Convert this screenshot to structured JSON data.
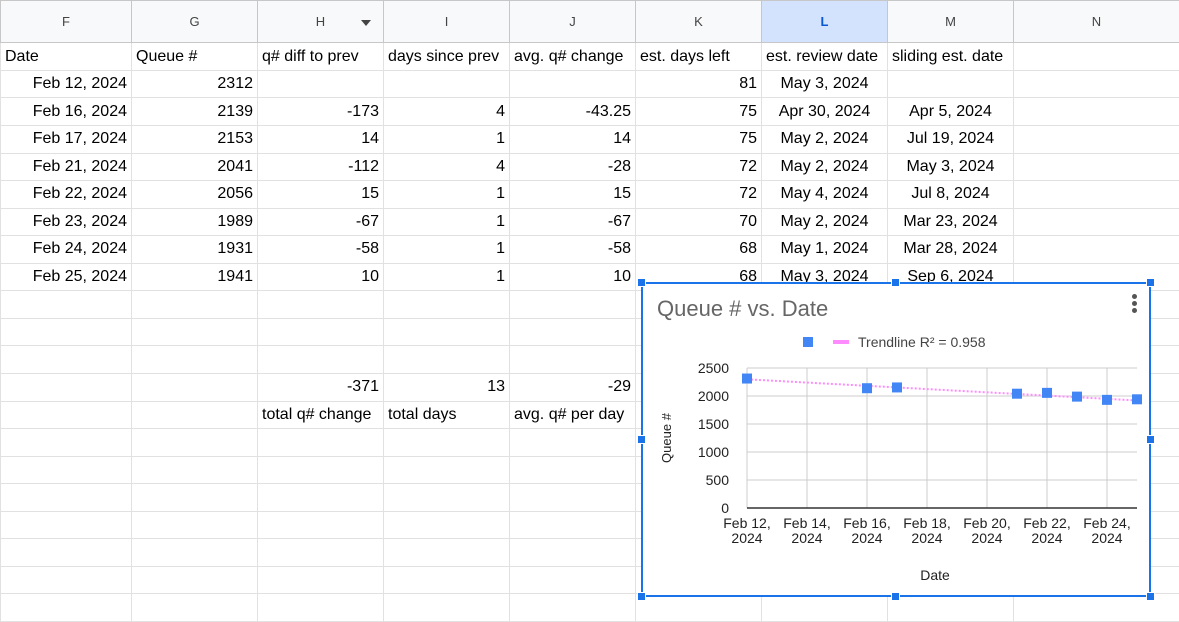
{
  "columns": [
    {
      "letter": "F",
      "selected": false
    },
    {
      "letter": "G",
      "selected": false
    },
    {
      "letter": "H",
      "selected": false,
      "filter": true
    },
    {
      "letter": "I",
      "selected": false
    },
    {
      "letter": "J",
      "selected": false
    },
    {
      "letter": "K",
      "selected": false
    },
    {
      "letter": "L",
      "selected": true
    },
    {
      "letter": "M",
      "selected": false
    },
    {
      "letter": "N",
      "selected": false
    }
  ],
  "headers": [
    "Date",
    "Queue #",
    "q# diff to prev",
    "days since prev",
    "avg. q# change",
    "est. days left",
    "est. review date",
    "sliding est. date"
  ],
  "rows": [
    {
      "date": "Feb 12, 2024",
      "queue": "2312",
      "diff": "",
      "days": "",
      "avg": "",
      "left": "81",
      "review": "May 3, 2024",
      "sliding": ""
    },
    {
      "date": "Feb 16, 2024",
      "queue": "2139",
      "diff": "-173",
      "days": "4",
      "avg": "-43.25",
      "left": "75",
      "review": "Apr 30, 2024",
      "sliding": "Apr 5, 2024"
    },
    {
      "date": "Feb 17, 2024",
      "queue": "2153",
      "diff": "14",
      "days": "1",
      "avg": "14",
      "left": "75",
      "review": "May 2, 2024",
      "sliding": "Jul 19, 2024"
    },
    {
      "date": "Feb 21, 2024",
      "queue": "2041",
      "diff": "-112",
      "days": "4",
      "avg": "-28",
      "left": "72",
      "review": "May 2, 2024",
      "sliding": "May 3, 2024"
    },
    {
      "date": "Feb 22, 2024",
      "queue": "2056",
      "diff": "15",
      "days": "1",
      "avg": "15",
      "left": "72",
      "review": "May 4, 2024",
      "sliding": "Jul 8, 2024"
    },
    {
      "date": "Feb 23, 2024",
      "queue": "1989",
      "diff": "-67",
      "days": "1",
      "avg": "-67",
      "left": "70",
      "review": "May 2, 2024",
      "sliding": "Mar 23, 2024"
    },
    {
      "date": "Feb 24, 2024",
      "queue": "1931",
      "diff": "-58",
      "days": "1",
      "avg": "-58",
      "left": "68",
      "review": "May 1, 2024",
      "sliding": "Mar 28, 2024"
    },
    {
      "date": "Feb 25, 2024",
      "queue": "1941",
      "diff": "10",
      "days": "1",
      "avg": "10",
      "left": "68",
      "review": "May 3, 2024",
      "sliding": "Sep 6, 2024"
    }
  ],
  "totals": {
    "q_change": "-371",
    "days": "13",
    "avg_per_day": "-29"
  },
  "totals_labels": {
    "q_change": "total q# change",
    "days": "total days",
    "avg_per_day": "avg. q# per day"
  },
  "colors": {
    "selection": "#1a73e8",
    "series": "#4285f4",
    "trendline": "#ff8cff"
  },
  "chart_data": {
    "type": "scatter",
    "title": "Queue # vs. Date",
    "xlabel": "Date",
    "ylabel": "Queue #",
    "ylim": [
      0,
      2500
    ],
    "yticks": [
      0,
      500,
      1000,
      1500,
      2000,
      2500
    ],
    "xticks": [
      "Feb 12, 2024",
      "Feb 14, 2024",
      "Feb 16, 2024",
      "Feb 18, 2024",
      "Feb 20, 2024",
      "Feb 22, 2024",
      "Feb 24, 2024"
    ],
    "xlim": [
      "Feb 12, 2024",
      "Feb 25, 2024"
    ],
    "grid": true,
    "legend_position": "top",
    "series": [
      {
        "x": [
          "Feb 12, 2024",
          "Feb 16, 2024",
          "Feb 17, 2024",
          "Feb 21, 2024",
          "Feb 22, 2024",
          "Feb 23, 2024",
          "Feb 24, 2024",
          "Feb 25, 2024"
        ],
        "y": [
          2312,
          2139,
          2153,
          2041,
          2056,
          1989,
          1931,
          1941
        ]
      }
    ],
    "trendline": {
      "label": "Trendline R² = 0.958",
      "start": 2298,
      "end": 1920
    }
  }
}
